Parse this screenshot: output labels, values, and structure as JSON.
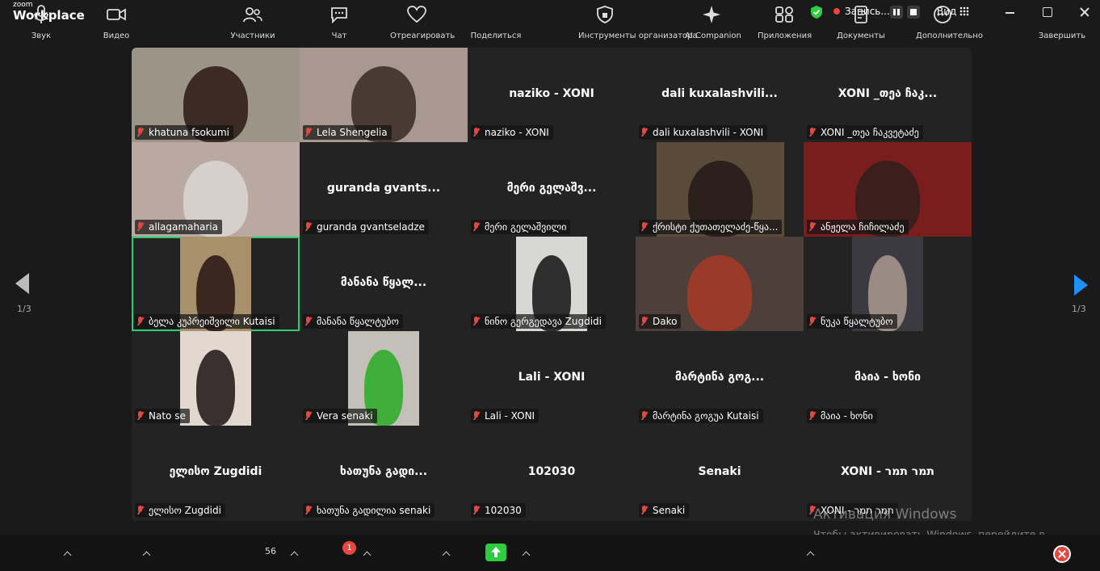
{
  "app": {
    "brand_small": "zoom",
    "brand_name": "Workplace"
  },
  "titlebar": {
    "recording_label": "Запись...",
    "view_label": "Вид"
  },
  "pagination": {
    "left": "1/3",
    "right": "1/3"
  },
  "tiles": [
    {
      "big": "",
      "tag": "khatuna fsokumi",
      "video": "#9c9487",
      "person": "#3c2a24"
    },
    {
      "big": "",
      "tag": "Lela Shengelia",
      "video": "#a89890",
      "person": "#4a3a34"
    },
    {
      "big": "naziko - XONI",
      "tag": "naziko - XONI"
    },
    {
      "big": "dali kuxalashvili...",
      "tag": "dali kuxalashvili - XONI"
    },
    {
      "big": "XONI _თეა ჩაკ...",
      "tag": "XONI _თეა ჩაკვეტაძე"
    },
    {
      "big": "",
      "tag": "allagamaharia",
      "video": "#b9a9a0",
      "person": "#d5d0cb"
    },
    {
      "big": "guranda gvants...",
      "tag": "guranda gvantseladze"
    },
    {
      "big": "მერი გელაშვ...",
      "tag": "მერი გელაშვილი"
    },
    {
      "big": "",
      "tag": "ქრისტი ქუთათელაძე-წყა...",
      "video": "#5a4a3a",
      "person": "#2b201b"
    },
    {
      "big": "",
      "tag": "ანჟელა ჩიჩილაძე",
      "video": "#7a1d1d",
      "person": "#3b1f1c"
    },
    {
      "big": "",
      "tag": "ბელა კუპრეიშვილი Kutaisi",
      "video": "#a8906c",
      "person": "#3a2820"
    },
    {
      "big": "მანანა წყალ...",
      "tag": "მანანა წყალტუბო"
    },
    {
      "big": "",
      "tag": "ნინო გერგედავა Zugdidi",
      "video": "#d7d7d4",
      "person": "#2f2f2f"
    },
    {
      "big": "",
      "tag": "Dako",
      "video": "#4f3f3b",
      "person": "#9a3b2a"
    },
    {
      "big": "",
      "tag": "ნუკა წყალტუბო",
      "video": "#3a3a40",
      "person": "#9a8c84"
    },
    {
      "big": "",
      "tag": "Nato se",
      "video": "#e2d8cf",
      "person": "#3a3030"
    },
    {
      "big": "",
      "tag": "Vera senaki",
      "video": "#c2c0b8",
      "person": "#3fae3a"
    },
    {
      "big": "Lali - XONI",
      "tag": "Lali - XONI"
    },
    {
      "big": "მარტინა გოგ...",
      "tag": "მარტინა გოგუა Kutaisi"
    },
    {
      "big": "მაია - ხონი",
      "tag": "მაია - ხონი"
    },
    {
      "big": "ელისო Zugdidi",
      "tag": "ელისო Zugdidi"
    },
    {
      "big": "ხათუნა გადი...",
      "tag": "ხათუნა გადილია senaki"
    },
    {
      "big": "102030",
      "tag": "102030"
    },
    {
      "big": "Senaki",
      "tag": "Senaki"
    },
    {
      "big": "XONI - תמר תמר",
      "tag": "XONI - תמר תמר"
    }
  ],
  "toolbar": {
    "audio": "Звук",
    "video": "Видео",
    "participants": "Участники",
    "participants_count": "56",
    "chat": "Чат",
    "chat_badge": "1",
    "react": "Отреагировать",
    "share": "Поделиться",
    "host_tools": "Инструменты организатора",
    "ai": "AI Companion",
    "apps": "Приложения",
    "notes": "Документы",
    "more": "Дополнительно",
    "end": "Завершить"
  },
  "watermark": {
    "title": "Активация Windows",
    "text": "Чтобы активировать Windows, перейдите в раздел \"Параметры\"."
  }
}
